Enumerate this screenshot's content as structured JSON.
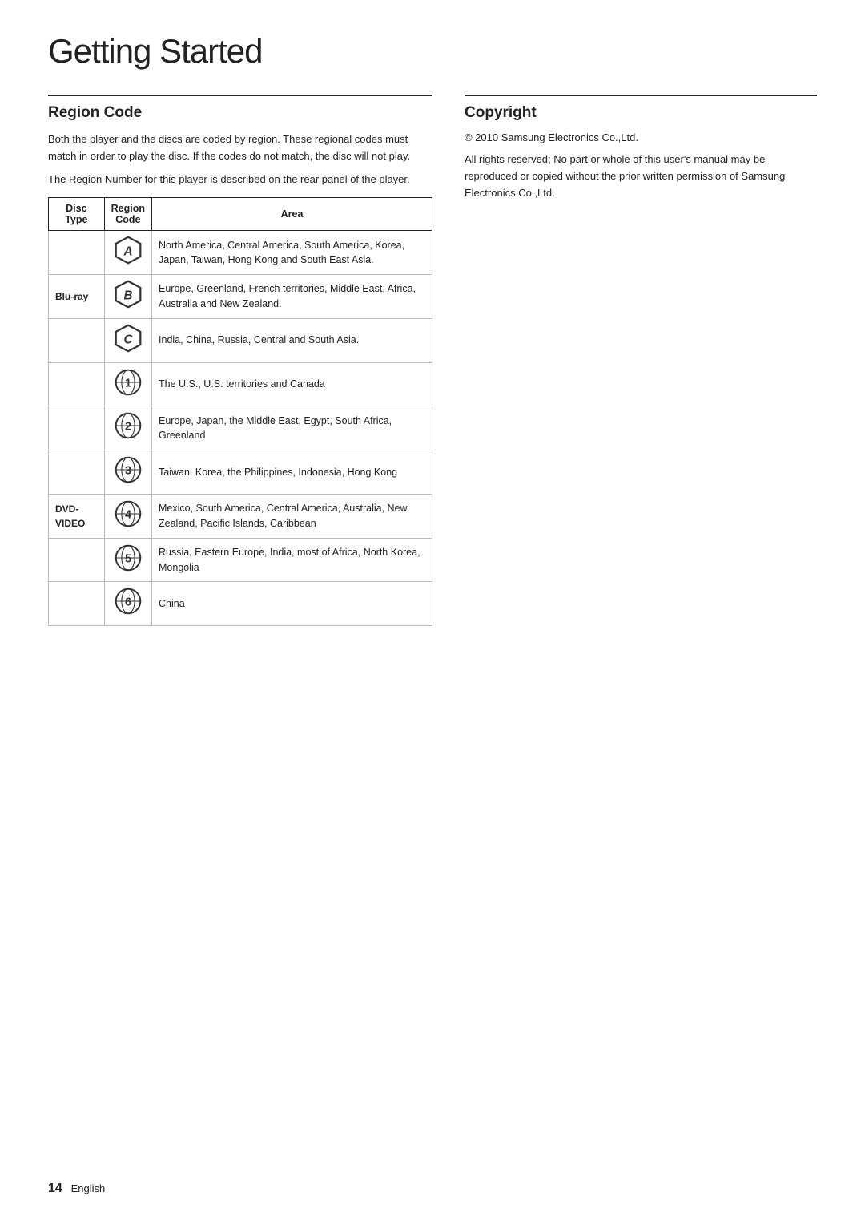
{
  "page": {
    "title": "Getting Started",
    "footer": {
      "page_number": "14",
      "language": "English"
    }
  },
  "region_code": {
    "section_title": "Region Code",
    "intro_paragraphs": [
      "Both the player and the discs are coded by region. These regional codes must match in order to play the disc. If the codes do not match, the disc will not play.",
      "The Region Number for this player is described on the rear panel of the player."
    ],
    "table": {
      "headers": [
        "Disc Type",
        "Region Code",
        "Area"
      ],
      "rows": [
        {
          "disc_type": "",
          "icon": "A",
          "type": "bluray-letter",
          "area": "North America, Central America, South America, Korea, Japan, Taiwan, Hong Kong and South East Asia."
        },
        {
          "disc_type": "Blu-ray",
          "icon": "B",
          "type": "bluray-letter",
          "area": "Europe, Greenland, French territories, Middle East, Africa, Australia and New Zealand."
        },
        {
          "disc_type": "",
          "icon": "C",
          "type": "bluray-letter",
          "area": "India, China, Russia, Central and South Asia."
        },
        {
          "disc_type": "",
          "icon": "1",
          "type": "dvd-number",
          "area": "The U.S., U.S. territories and Canada"
        },
        {
          "disc_type": "",
          "icon": "2",
          "type": "dvd-number",
          "area": "Europe, Japan, the Middle East, Egypt, South Africa, Greenland"
        },
        {
          "disc_type": "",
          "icon": "3",
          "type": "dvd-number",
          "area": "Taiwan, Korea, the Philippines, Indonesia, Hong Kong"
        },
        {
          "disc_type": "DVD-VIDEO",
          "icon": "4",
          "type": "dvd-number",
          "area": "Mexico, South America, Central America, Australia, New Zealand, Pacific Islands, Caribbean"
        },
        {
          "disc_type": "",
          "icon": "5",
          "type": "dvd-number",
          "area": "Russia, Eastern Europe, India, most of Africa, North Korea, Mongolia"
        },
        {
          "disc_type": "",
          "icon": "6",
          "type": "dvd-number",
          "area": "China"
        }
      ]
    }
  },
  "copyright": {
    "section_title": "Copyright",
    "year_line": "© 2010 Samsung Electronics Co.,Ltd.",
    "body_text": "All rights reserved; No part or whole of this user's manual may be reproduced or copied without the prior written permission of Samsung Electronics Co.,Ltd."
  }
}
